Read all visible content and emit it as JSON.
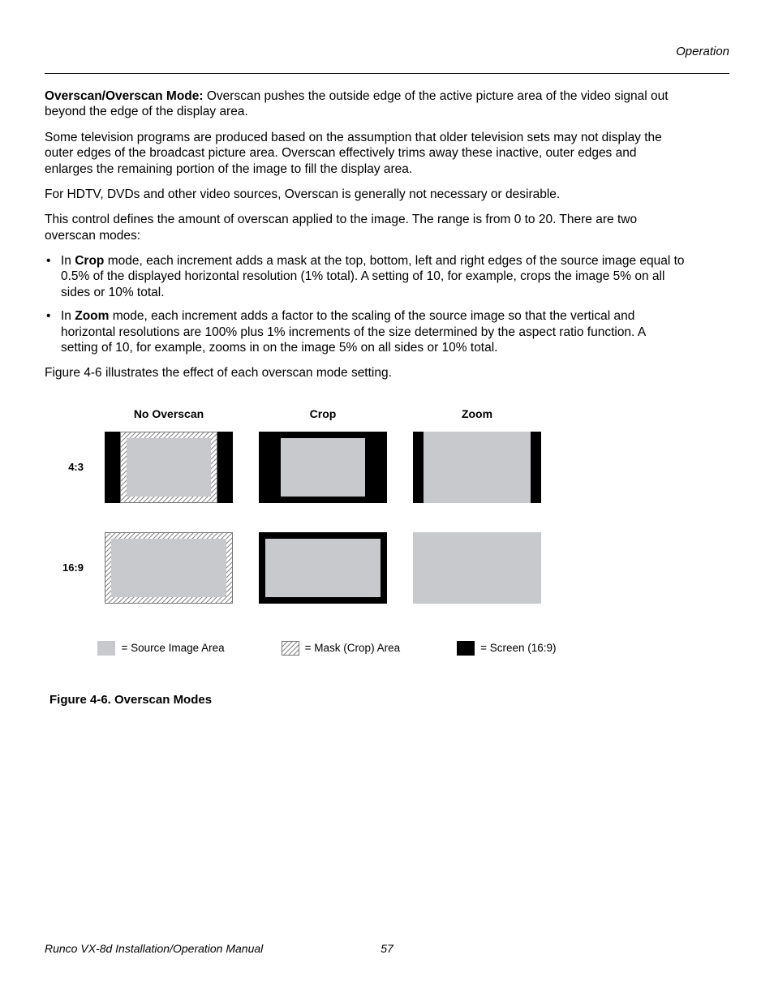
{
  "header": {
    "section": "Operation"
  },
  "content": {
    "p1_bold": "Overscan/Overscan Mode:",
    "p1_rest": " Overscan pushes the outside edge of the active picture area of the video signal out beyond the edge of the display area.",
    "p2": "Some television programs are produced based on the assumption that older television sets may not display the outer edges of the broadcast picture area. Overscan effectively trims away these inactive, outer edges and enlarges the remaining portion of the image to fill the display area.",
    "p3": "For HDTV, DVDs and other video sources, Overscan is generally not necessary or desirable.",
    "p4": "This control defines the amount of overscan applied to the image. The range is from 0 to 20. There are two overscan modes:",
    "bullet1_pre": "In ",
    "bullet1_bold": "Crop",
    "bullet1_post": " mode, each increment adds a mask at the top, bottom, left and right edges of the source image equal to 0.5% of the displayed horizontal resolution (1% total). A setting of 10, for example, crops the image 5% on all sides or 10% total.",
    "bullet2_pre": "In ",
    "bullet2_bold": "Zoom",
    "bullet2_post": " mode, each increment adds a factor to the scaling of the source image so that the vertical and horizontal resolutions are 100% plus 1% increments of the size determined by the aspect ratio function. A setting of 10, for example, zooms in on the image 5% on all sides or 10% total.",
    "p5": "Figure 4-6 illustrates the effect of each overscan mode setting."
  },
  "figure": {
    "col1": "No Overscan",
    "col2": "Crop",
    "col3": "Zoom",
    "row1": "4:3",
    "row2": "16:9",
    "legend1": "= Source Image Area",
    "legend2": "= Mask (Crop) Area",
    "legend3": "= Screen (16:9)",
    "caption": "Figure 4-6. Overscan Modes"
  },
  "footer": {
    "doc_title": "Runco VX-8d Installation/Operation Manual",
    "page_num": "57"
  }
}
